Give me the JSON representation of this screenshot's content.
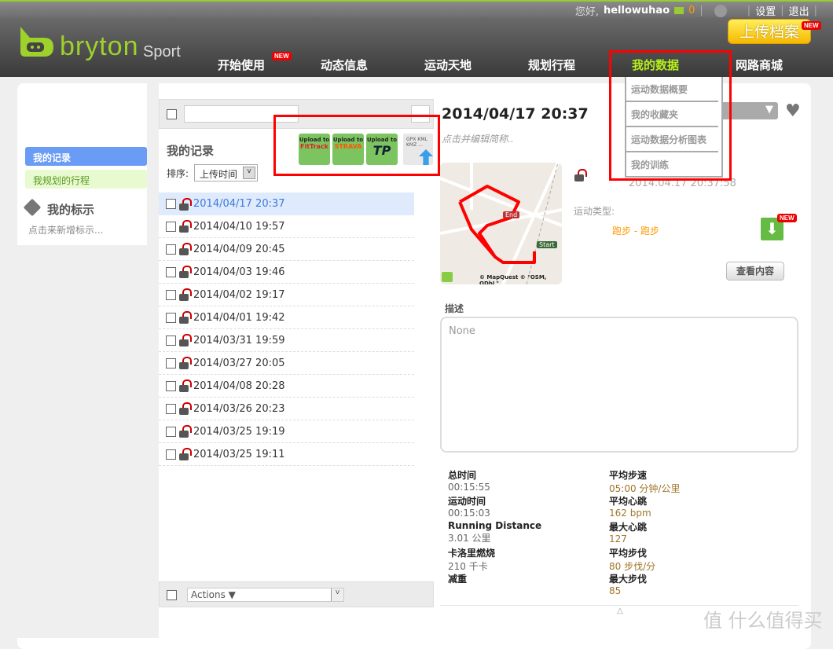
{
  "topbar": {
    "greeting": "您好,",
    "username": "hellowuhao",
    "mail_count": "0",
    "settings": "设置",
    "logout": "退出",
    "icons": [
      "mail-icon",
      "globe-icon"
    ]
  },
  "brand": {
    "logo": "bryton",
    "sub": "Sport"
  },
  "upload_button": "上传档案",
  "new_badge": "NEW",
  "nav": [
    {
      "label": "开始使用"
    },
    {
      "label": "动态信息"
    },
    {
      "label": "运动天地"
    },
    {
      "label": "规划行程"
    },
    {
      "label": "我的数据",
      "active": true
    },
    {
      "label": "网路商城"
    }
  ],
  "dropdown": [
    "运动数据概要",
    "我的收藏夹",
    "运动数据分析图表",
    "我的训练"
  ],
  "sidebar": {
    "items": [
      "我的记录",
      "我规划的行程"
    ],
    "tags_title": "我的标示",
    "tags_hint": "点击来新增标示..."
  },
  "list": {
    "title": "我的记录",
    "sort_label": "排序:",
    "sort_value": "上传时间",
    "search_value": "",
    "upload_targets": [
      "FitTrack",
      "STRAVA",
      "TP",
      "GPX KML KMZ ..."
    ],
    "upload_to": "Upload to",
    "records": [
      "2014/04/17 20:37",
      "2014/04/10 19:57",
      "2014/04/09 20:45",
      "2014/04/03 19:46",
      "2014/04/02 19:17",
      "2014/04/01 19:42",
      "2014/03/31 19:59",
      "2014/03/27 20:05",
      "2014/04/08 20:28",
      "2014/03/26 20:23",
      "2014/03/25 19:19",
      "2014/03/25 19:11"
    ],
    "actions": "Actions ▼"
  },
  "detail": {
    "title": "2014/04/17 20:37",
    "edit_hint": "点击并编辑简称..",
    "timestamp": "2014.04.17 20:37:58",
    "sport_type_label": "运动类型:",
    "sport_type": "跑步 - 跑步",
    "view_button": "查看内容",
    "map": {
      "end": "End",
      "start": "Start",
      "attribution": "© MapQuest © \"OSM, ODbL\""
    },
    "desc_label": "描述",
    "desc_value": "None",
    "stats_left": [
      {
        "label": "总时间",
        "value": "00:15:55"
      },
      {
        "label": "运动时间",
        "value": "00:15:03"
      },
      {
        "label": "Running Distance",
        "value": "3.01 公里"
      },
      {
        "label": "卡洛里燃烧",
        "value": "210 千卡"
      },
      {
        "label": "减重",
        "value": ""
      }
    ],
    "stats_right": [
      {
        "label": "平均步速",
        "value": "05:00 分钟/公里"
      },
      {
        "label": "平均心跳",
        "value": "162 bpm"
      },
      {
        "label": "最大心跳",
        "value": "127"
      },
      {
        "label": "平均步伐",
        "value": "80 步伐/分"
      },
      {
        "label": "最大步伐",
        "value": "85"
      }
    ]
  },
  "watermark": "值 什么值得买",
  "colors": {
    "brand_green": "#9ed12a",
    "active_nav": "#b6f018",
    "selected_side": "#6b9cf5",
    "highlight": "#ff0000"
  }
}
